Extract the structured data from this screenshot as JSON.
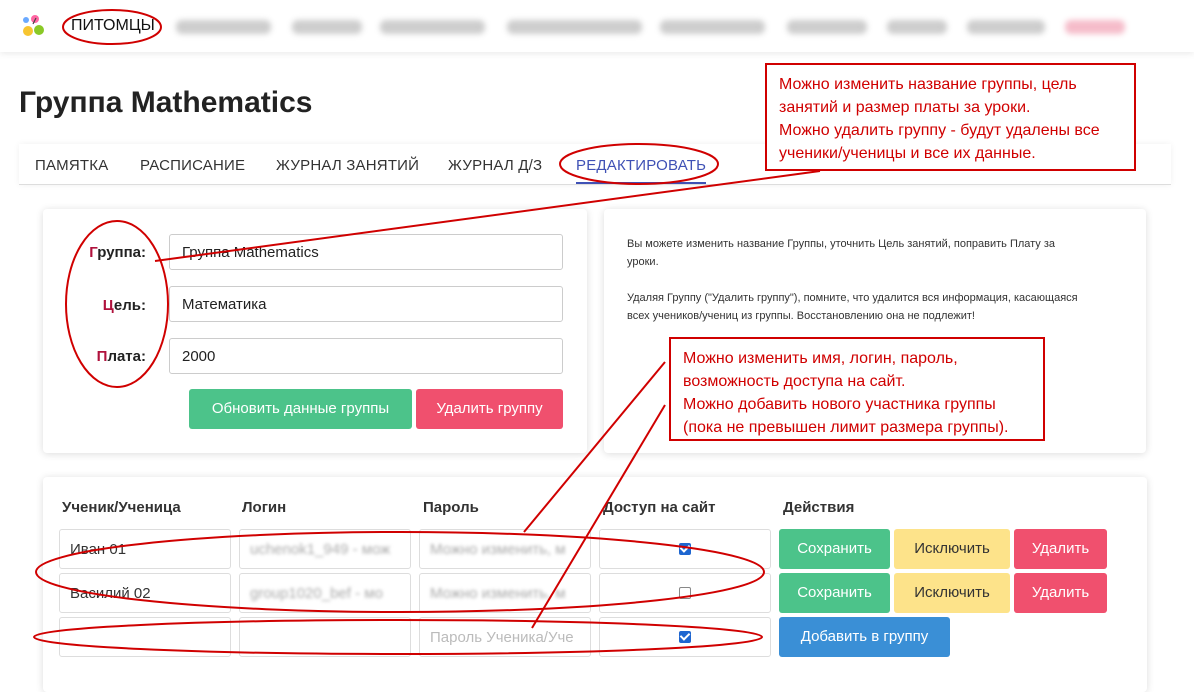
{
  "topnav": {
    "active_label": "ПИТОМЦЫ"
  },
  "page": {
    "title": "Группа Mathematics"
  },
  "tabs": [
    {
      "label": "ПАМЯТКА"
    },
    {
      "label": "РАСПИСАНИЕ"
    },
    {
      "label": "ЖУРНАЛ ЗАНЯТИЙ"
    },
    {
      "label": "ЖУРНАЛ Д/З"
    },
    {
      "label": "РЕДАКТИРОВАТЬ"
    }
  ],
  "group_form": {
    "group_label_first": "Г",
    "group_label_rest": "руппа:",
    "group_value": "Группа Mathematics",
    "goal_label_first": "Ц",
    "goal_label_rest": "ель:",
    "goal_value": "Математика",
    "fee_label_first": "П",
    "fee_label_rest": "лата:",
    "fee_value": "2000",
    "update_button": "Обновить данные группы",
    "delete_button": "Удалить группу"
  },
  "info": {
    "line1": "Вы можете изменить название Группы, уточнить Цель занятий, поправить Плату за",
    "line2": "уроки.",
    "line3": "Удаляя Группу (\"Удалить группу\"), помните, что удалится вся информация, касающаяся",
    "line4": "всех учеников/учениц из группы. Восстановлению она не подлежит!"
  },
  "members_table": {
    "headers": [
      "Ученик/Ученица",
      "Логин",
      "Пароль",
      "Доступ на сайт",
      "Действия"
    ],
    "rows": [
      {
        "name": "Иван 01",
        "login": "uchenok1_949 - мож",
        "password": "Можно изменить, м",
        "access": true,
        "save": "Сохранить",
        "exclude": "Исключить",
        "delete": "Удалить"
      },
      {
        "name": "Василий 02",
        "login": "group1020_bef - мо",
        "password": "Можно изменить, м",
        "access": false,
        "save": "Сохранить",
        "exclude": "Исключить",
        "delete": "Удалить"
      }
    ],
    "new_row": {
      "password_placeholder": "Пароль Ученика/Уче",
      "access": true,
      "add_button": "Добавить в группу"
    }
  },
  "annotations": {
    "note1": [
      "Можно изменить название группы, цель",
      "занятий и размер платы за уроки.",
      "Можно удалить группу - будут удалены все",
      "ученики/ученицы и все их данные."
    ],
    "note2": [
      "Можно изменить имя, логин, пароль,",
      "возможность доступа на сайт.",
      "Можно добавить нового участника группы",
      "(пока не превышен лимит размера группы)."
    ]
  },
  "colors": {
    "accent": "#3f51b5",
    "annotation": "#d00000",
    "green": "#4cc38a",
    "red": "#f0506e",
    "yellow": "#fde38a",
    "blue": "#3a8fd6"
  }
}
